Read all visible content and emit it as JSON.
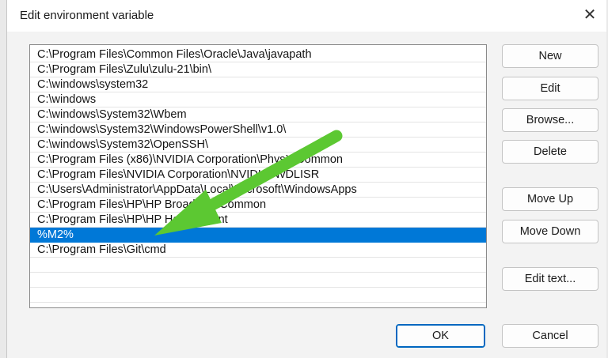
{
  "window": {
    "title": "Edit environment variable",
    "close_glyph": "✕"
  },
  "list": {
    "items": [
      {
        "text": "C:\\Program Files\\Common Files\\Oracle\\Java\\javapath",
        "selected": false
      },
      {
        "text": "C:\\Program Files\\Zulu\\zulu-21\\bin\\",
        "selected": false
      },
      {
        "text": "C:\\windows\\system32",
        "selected": false
      },
      {
        "text": "C:\\windows",
        "selected": false
      },
      {
        "text": "C:\\windows\\System32\\Wbem",
        "selected": false
      },
      {
        "text": "C:\\windows\\System32\\WindowsPowerShell\\v1.0\\",
        "selected": false
      },
      {
        "text": "C:\\windows\\System32\\OpenSSH\\",
        "selected": false
      },
      {
        "text": "C:\\Program Files (x86)\\NVIDIA Corporation\\PhysX\\Common",
        "selected": false
      },
      {
        "text": "C:\\Program Files\\NVIDIA Corporation\\NVIDIA NvDLISR",
        "selected": false
      },
      {
        "text": "C:\\Users\\Administrator\\AppData\\Local\\Microsoft\\WindowsApps",
        "selected": false
      },
      {
        "text": "C:\\Program Files\\HP\\HP Broadcast\\Common",
        "selected": false
      },
      {
        "text": "C:\\Program Files\\HP\\HP Home Agent",
        "selected": false
      },
      {
        "text": "%M2%",
        "selected": true
      },
      {
        "text": "C:\\Program Files\\Git\\cmd",
        "selected": false
      },
      {
        "text": "",
        "selected": false
      },
      {
        "text": "",
        "selected": false
      },
      {
        "text": "",
        "selected": false
      }
    ]
  },
  "buttons": {
    "new": "New",
    "edit": "Edit",
    "browse": "Browse...",
    "delete": "Delete",
    "move_up": "Move Up",
    "move_down": "Move Down",
    "edit_text": "Edit text...",
    "ok": "OK",
    "cancel": "Cancel"
  },
  "colors": {
    "selection": "#0078d7",
    "arrow": "#5cc832"
  },
  "annotation": {
    "icon": "green-arrow-icon"
  }
}
